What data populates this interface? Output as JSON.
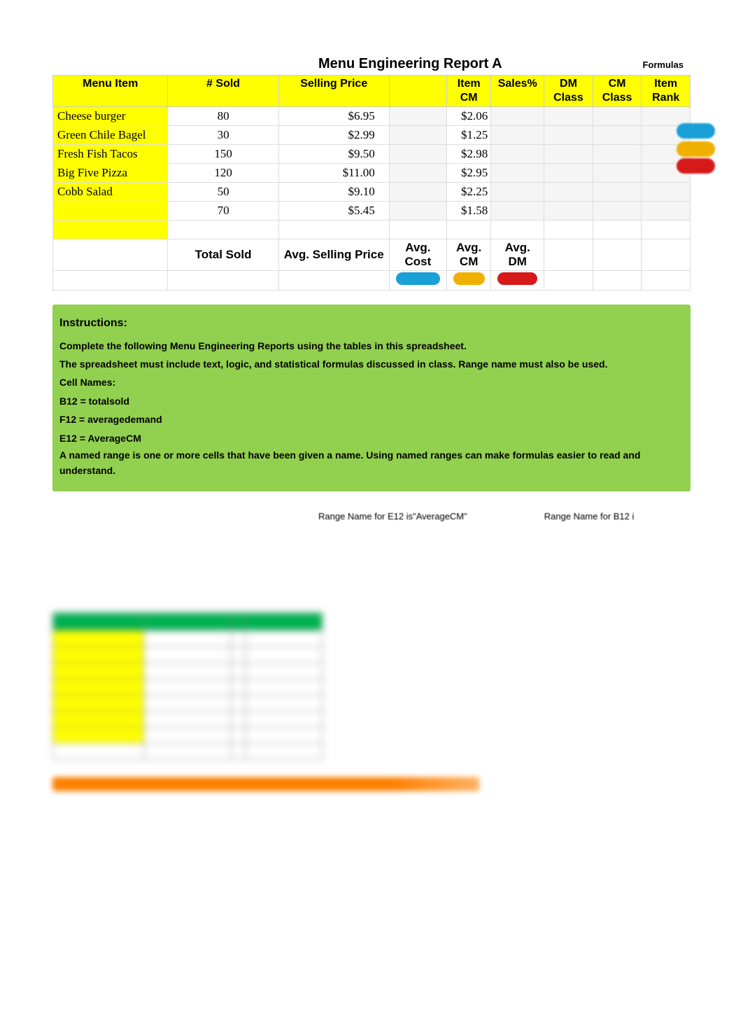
{
  "title": "Menu Engineering Report A",
  "formulas_label": "Formulas",
  "headers": {
    "menu_item": "Menu Item",
    "sold": "# Sold",
    "price": "Selling Price",
    "cost": "",
    "item_cm": "Item CM",
    "sales_pct": "Sales%",
    "dm_class": "DM Class",
    "cm_class": "CM Class",
    "item_rank": "Item Rank"
  },
  "rows": [
    {
      "name": "Cheese burger",
      "sold": "80",
      "price": "$6.95",
      "cm": "$2.06"
    },
    {
      "name": "Green Chile Bagel",
      "sold": "30",
      "price": "$2.99",
      "cm": "$1.25"
    },
    {
      "name": "Fresh Fish Tacos",
      "sold": "150",
      "price": "$9.50",
      "cm": "$2.98"
    },
    {
      "name": "Big Five Pizza",
      "sold": "120",
      "price": "$11.00",
      "cm": "$2.95"
    },
    {
      "name": "Cobb Salad",
      "sold": "50",
      "price": "$9.10",
      "cm": "$2.25"
    },
    {
      "name": "",
      "sold": "70",
      "price": "$5.45",
      "cm": "$1.58"
    }
  ],
  "totals": {
    "total_sold": "Total Sold",
    "avg_price": "Avg. Selling Price",
    "avg_cost": "Avg. Cost",
    "avg_cm": "Avg. CM",
    "avg_dm": "Avg. DM"
  },
  "instructions": {
    "heading": "Instructions:",
    "line1": "Complete the following Menu Engineering Reports using the tables in this spreadsheet.",
    "line2": "The spreadsheet must include text, logic, and statistical formulas discussed in class. Range name must also be used.",
    "cell_names": "Cell Names:",
    "b12": "B12 = totalsold",
    "f12": "F12 = averagedemand",
    "e12": "E12 = AverageCM",
    "named_range": "A named range is one or more cells that have been given a name. Using named ranges can make formulas easier to read and understand."
  },
  "range_note_e12": "Range Name for E12 is\"AverageCM\"",
  "range_note_b12": "Range Name for B12 i",
  "chart_data": {
    "type": "table",
    "title": "Menu Engineering Report A",
    "columns": [
      "Menu Item",
      "# Sold",
      "Selling Price",
      "Item CM",
      "Sales%",
      "DM Class",
      "CM Class",
      "Item Rank"
    ],
    "rows": [
      [
        "Cheese burger",
        80,
        6.95,
        2.06,
        null,
        null,
        null,
        null
      ],
      [
        "Green Chile Bagel",
        30,
        2.99,
        1.25,
        null,
        null,
        null,
        null
      ],
      [
        "Fresh Fish Tacos",
        150,
        9.5,
        2.98,
        null,
        null,
        null,
        null
      ],
      [
        "Big Five Pizza",
        120,
        11.0,
        2.95,
        null,
        null,
        null,
        null
      ],
      [
        "Cobb Salad",
        50,
        9.1,
        2.25,
        null,
        null,
        null,
        null
      ],
      [
        "",
        70,
        5.45,
        1.58,
        null,
        null,
        null,
        null
      ]
    ],
    "summary_labels": [
      "Total Sold",
      "Avg. Selling Price",
      "Avg. Cost",
      "Avg. CM",
      "Avg. DM"
    ]
  }
}
